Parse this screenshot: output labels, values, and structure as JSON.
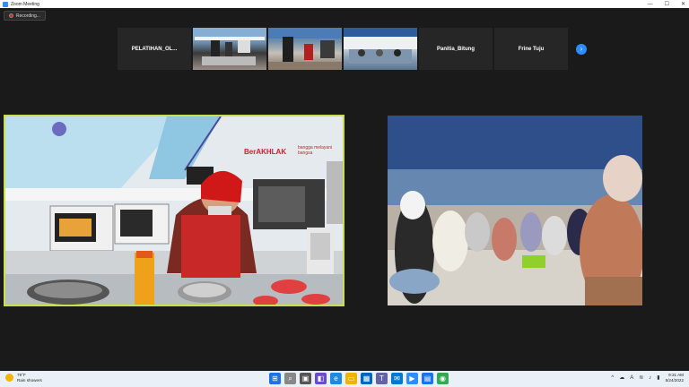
{
  "window": {
    "title": "Zoom Meeting",
    "controls": [
      "—",
      "☐",
      "✕"
    ]
  },
  "recording": {
    "label": "Recording..."
  },
  "gallery": {
    "tiles": [
      {
        "type": "name",
        "label": "PELATIHAN_OL..."
      },
      {
        "type": "video",
        "label": ""
      },
      {
        "type": "video",
        "label": ""
      },
      {
        "type": "video",
        "label": ""
      },
      {
        "type": "name",
        "label": "Panitia_Bitung"
      },
      {
        "type": "name",
        "label": "Frine Tuju"
      }
    ],
    "next_icon": "chevron-right-icon"
  },
  "left_video": {
    "banner_brand": "BerAKHLAK",
    "banner_tag": "bangga melayani bangsa"
  },
  "taskbar": {
    "weather_temp": "79°F",
    "weather_desc": "Rain showers",
    "time": "9:31 AM",
    "date": "5/24/2022"
  }
}
